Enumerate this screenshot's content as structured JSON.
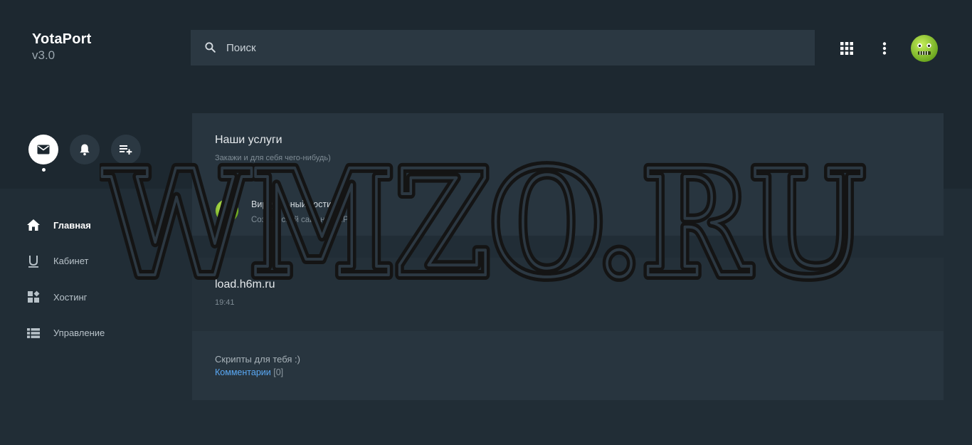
{
  "brand": {
    "name": "YotaPort",
    "version": "v3.0"
  },
  "search": {
    "placeholder": "Поиск"
  },
  "topbar": {
    "apps_icon": "apps-grid-icon",
    "more_icon": "more-vert-icon",
    "avatar_icon": "green-face-avatar"
  },
  "quick_actions": {
    "mail_icon": "mail-icon",
    "bell_icon": "bell-icon",
    "playlist_icon": "playlist-add-icon",
    "active": "mail"
  },
  "nav": {
    "items": [
      {
        "label": "Главная",
        "icon": "home-icon",
        "active": true
      },
      {
        "label": "Кабинет",
        "icon": "user-u-icon",
        "active": false
      },
      {
        "label": "Хостинг",
        "icon": "widgets-icon",
        "active": false
      },
      {
        "label": "Управление",
        "icon": "list-icon",
        "active": false
      }
    ]
  },
  "services_card": {
    "title": "Наши услуги",
    "subtitle": "Закажи и для себя чего-нибудь)",
    "item": {
      "title": "Виртуальный хостинг",
      "description": "Создай свой сайт на PHP"
    }
  },
  "load_card": {
    "title": "load.h6m.ru",
    "time": "19:41"
  },
  "scripts_card": {
    "text": "Скрипты для тебя :)",
    "link": "Комментарии",
    "count": "[0]"
  },
  "watermark": {
    "text": "WMZO.RU"
  },
  "colors": {
    "background": "#212d36",
    "top_band": "#1d2830",
    "card": "#28353f",
    "link": "#5aa9f5",
    "avatar_green": "#9bd23a"
  }
}
